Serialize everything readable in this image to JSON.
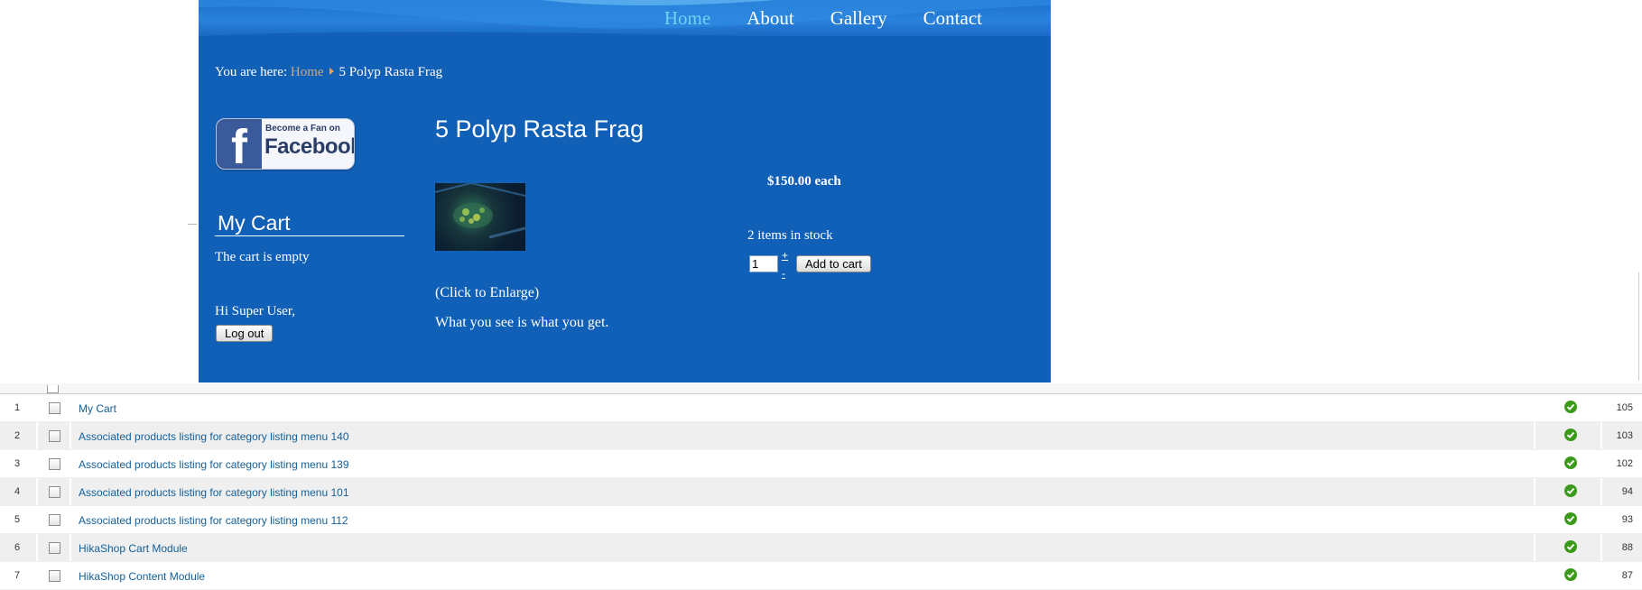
{
  "nav": {
    "items": [
      {
        "label": "Home",
        "active": true
      },
      {
        "label": "About",
        "active": false
      },
      {
        "label": "Gallery",
        "active": false
      },
      {
        "label": "Contact",
        "active": false
      }
    ]
  },
  "breadcrumb": {
    "prefix": "You are here:",
    "home": "Home",
    "current": "5 Polyp Rasta Frag"
  },
  "facebook": {
    "line1": "Become a Fan on",
    "line2": "Facebook",
    "letter": "f"
  },
  "cart": {
    "title": "My Cart",
    "empty_text": "The cart is empty"
  },
  "user": {
    "greeting": "Hi Super User,",
    "logout_label": "Log out"
  },
  "product": {
    "title": "5 Polyp Rasta Frag",
    "price": "$150.00 each",
    "stock": "2 items in stock",
    "quantity": "1",
    "plus": "+",
    "minus": "-",
    "add_to_cart": "Add to cart",
    "click_to_enlarge": "(Click to Enlarge)",
    "description": "What you see is what you get."
  },
  "table": {
    "rows": [
      {
        "num": "1",
        "title": "My Cart",
        "id": "105"
      },
      {
        "num": "2",
        "title": "Associated products listing for category listing menu 140",
        "id": "103"
      },
      {
        "num": "3",
        "title": "Associated products listing for category listing menu 139",
        "id": "102"
      },
      {
        "num": "4",
        "title": "Associated products listing for category listing menu 101",
        "id": "94"
      },
      {
        "num": "5",
        "title": "Associated products listing for category listing menu 112",
        "id": "93"
      },
      {
        "num": "6",
        "title": "HikaShop Cart Module",
        "id": "88"
      },
      {
        "num": "7",
        "title": "HikaShop Content Module",
        "id": "87"
      }
    ],
    "status_icon": "published-check-icon"
  },
  "colors": {
    "site_bg": "#1160b8",
    "nav_active": "#6fd2f3",
    "link": "#14609a",
    "status_green": "#3c9a1a"
  }
}
